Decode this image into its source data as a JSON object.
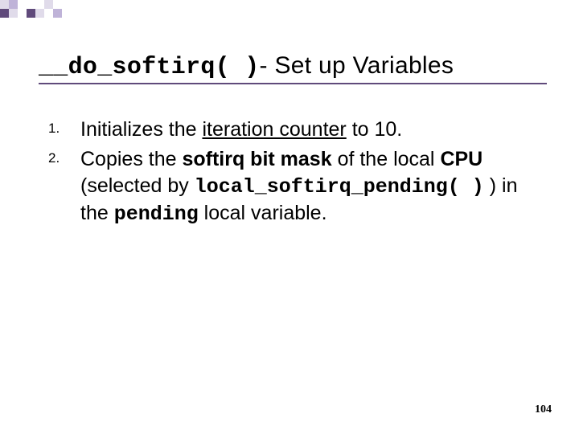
{
  "deco": {
    "row1": [
      {
        "c": "#e0dbea",
        "s": 11
      },
      {
        "c": "#bfb3d8",
        "s": 11
      },
      {
        "c": "transparent",
        "s": 11
      },
      {
        "c": "transparent",
        "s": 11
      },
      {
        "c": "transparent",
        "s": 11
      },
      {
        "c": "#e0dbea",
        "s": 11
      }
    ],
    "row2": [
      {
        "c": "#604a7b",
        "s": 11
      },
      {
        "c": "#e0dbea",
        "s": 11
      },
      {
        "c": "transparent",
        "s": 11
      },
      {
        "c": "#604a7b",
        "s": 11
      },
      {
        "c": "#e0dbea",
        "s": 11
      },
      {
        "c": "transparent",
        "s": 11
      },
      {
        "c": "#bfb3d8",
        "s": 11
      }
    ]
  },
  "title": {
    "code": "__do_softirq( )",
    "rest": "- Set up Variables"
  },
  "items": [
    {
      "pre": "Initializes the ",
      "u": "iteration counter",
      "post": " to 10."
    },
    {
      "t1": "Copies the ",
      "b1": "softirq bit mask",
      "t2": " of the local ",
      "b2": "CPU",
      "t3": " (selected by ",
      "m1": "local_softirq_pending( )",
      "t4": " ) in the ",
      "m2": "pending",
      "t5": " local variable."
    }
  ],
  "page": "104"
}
